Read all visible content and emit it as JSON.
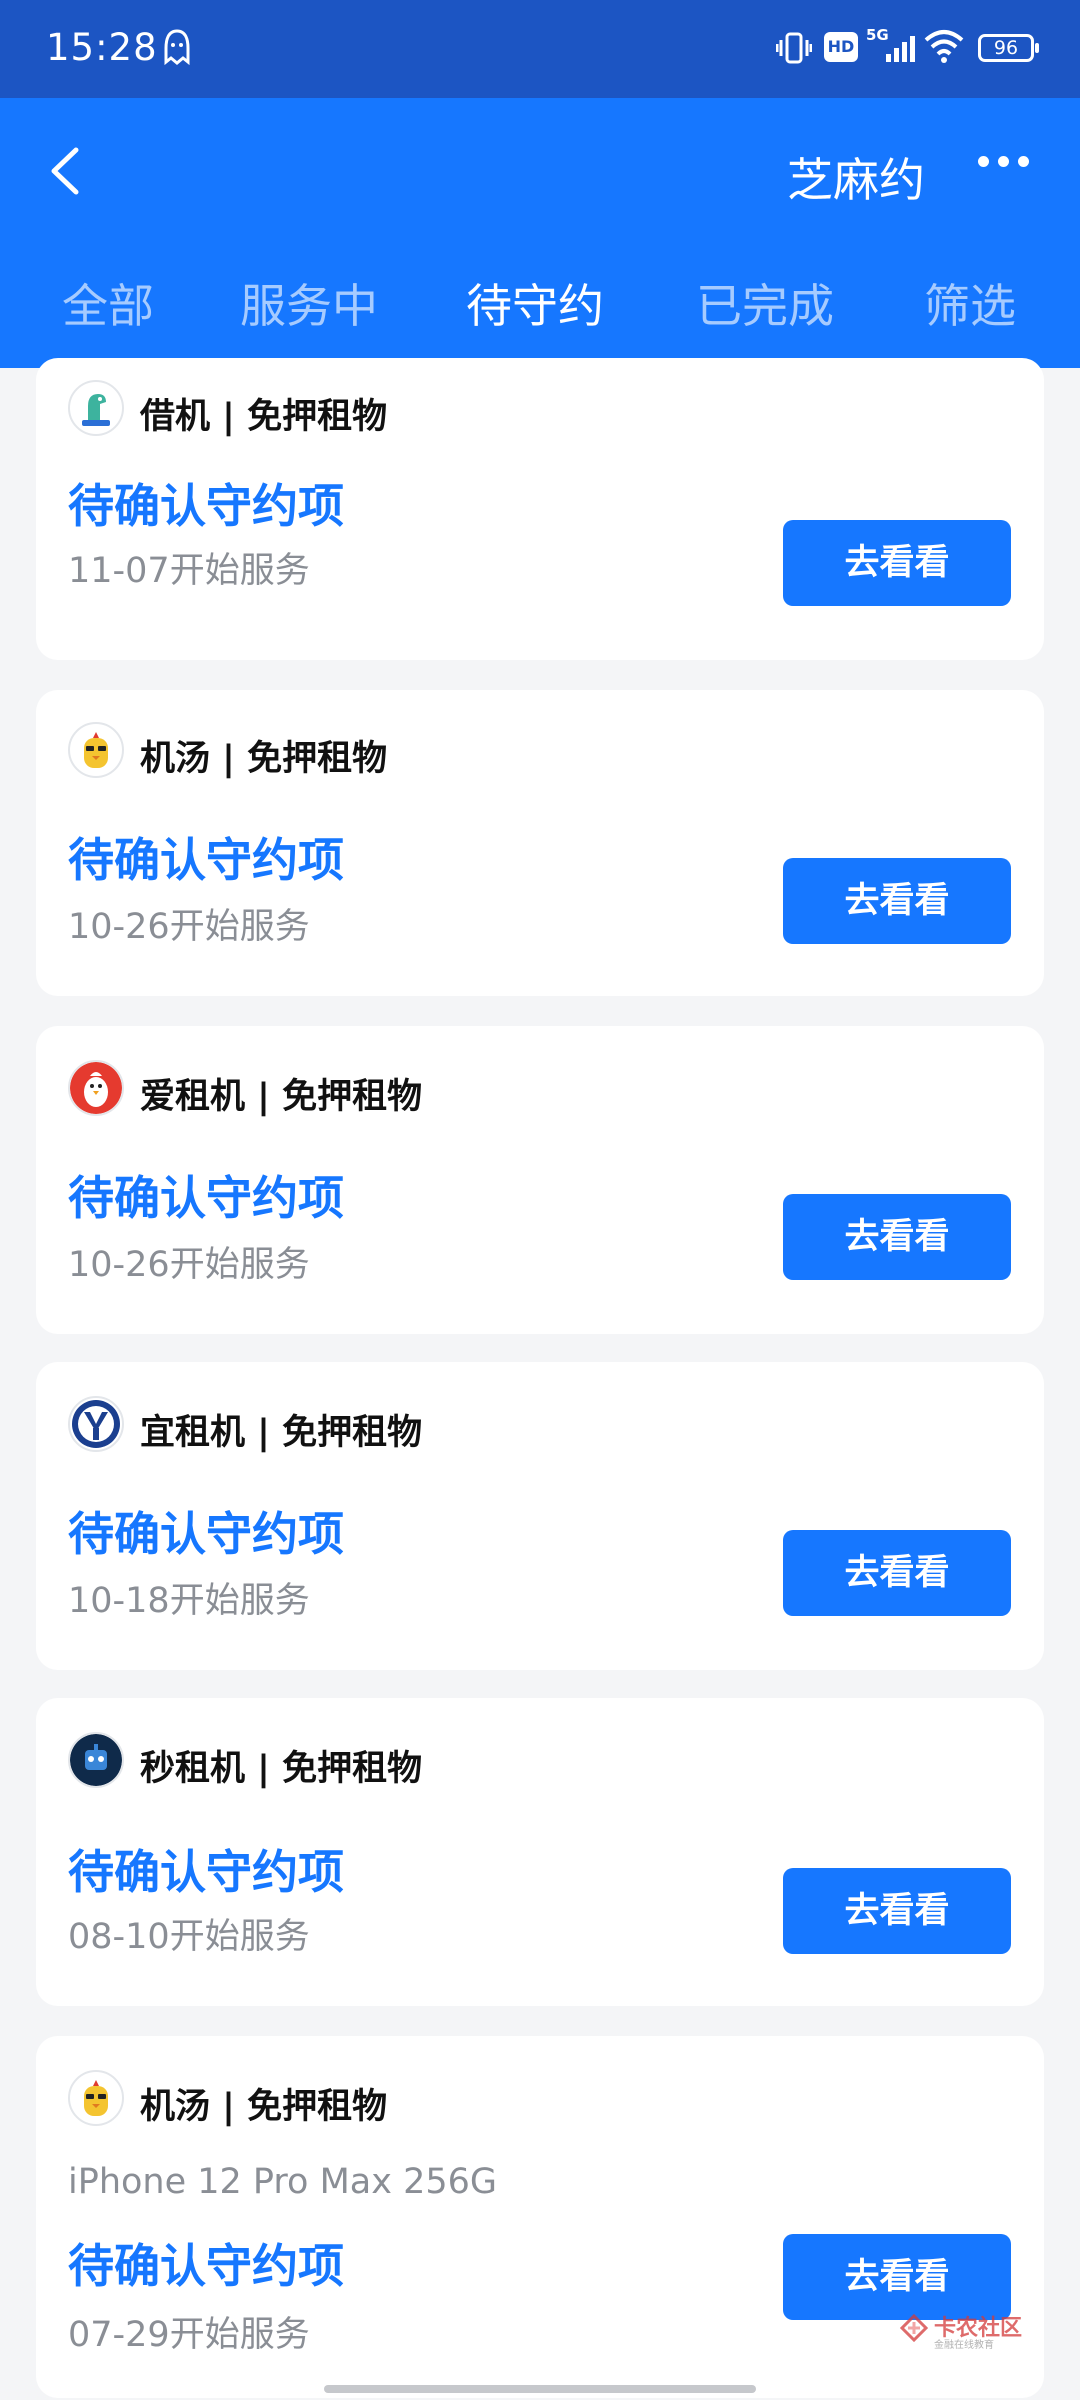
{
  "status_bar": {
    "time": "15:28",
    "battery": "96",
    "hd_label": "HD",
    "network": "5G"
  },
  "header": {
    "title": "芝麻约",
    "back_icon": "chevron-left-icon",
    "more_icon": "more-dots-icon"
  },
  "tabs": [
    {
      "label": "全部",
      "active": false
    },
    {
      "label": "服务中",
      "active": false
    },
    {
      "label": "待守约",
      "active": true
    },
    {
      "label": "已完成",
      "active": false
    },
    {
      "label": "筛选",
      "active": false
    }
  ],
  "cards": [
    {
      "merchant": "借机 | 免押租物",
      "status": "待确认守约项",
      "date": "11-07开始服务",
      "button": "去看看",
      "logo": "dinosaur-logo"
    },
    {
      "merchant": "机汤 | 免押租物",
      "status": "待确认守约项",
      "date": "10-26开始服务",
      "button": "去看看",
      "logo": "chick-logo"
    },
    {
      "merchant": "爱租机 | 免押租物",
      "status": "待确认守约项",
      "date": "10-26开始服务",
      "button": "去看看",
      "logo": "penguin-logo"
    },
    {
      "merchant": "宜租机 | 免押租物",
      "status": "待确认守约项",
      "date": "10-18开始服务",
      "button": "去看看",
      "logo": "y-badge-logo"
    },
    {
      "merchant": "秒租机 | 免押租物",
      "status": "待确认守约项",
      "date": "08-10开始服务",
      "button": "去看看",
      "logo": "robot-logo"
    },
    {
      "merchant": "机汤 | 免押租物",
      "item": "iPhone 12 Pro Max 256G",
      "status": "待确认守约项",
      "date": "07-29开始服务",
      "button": "去看看",
      "logo": "chick-logo"
    }
  ],
  "watermark": {
    "text": "卡农社区",
    "sub": "金融在线教育"
  },
  "colors": {
    "primary": "#1677ff",
    "status_bar": "#1c55c3",
    "background": "#f4f5f7"
  }
}
